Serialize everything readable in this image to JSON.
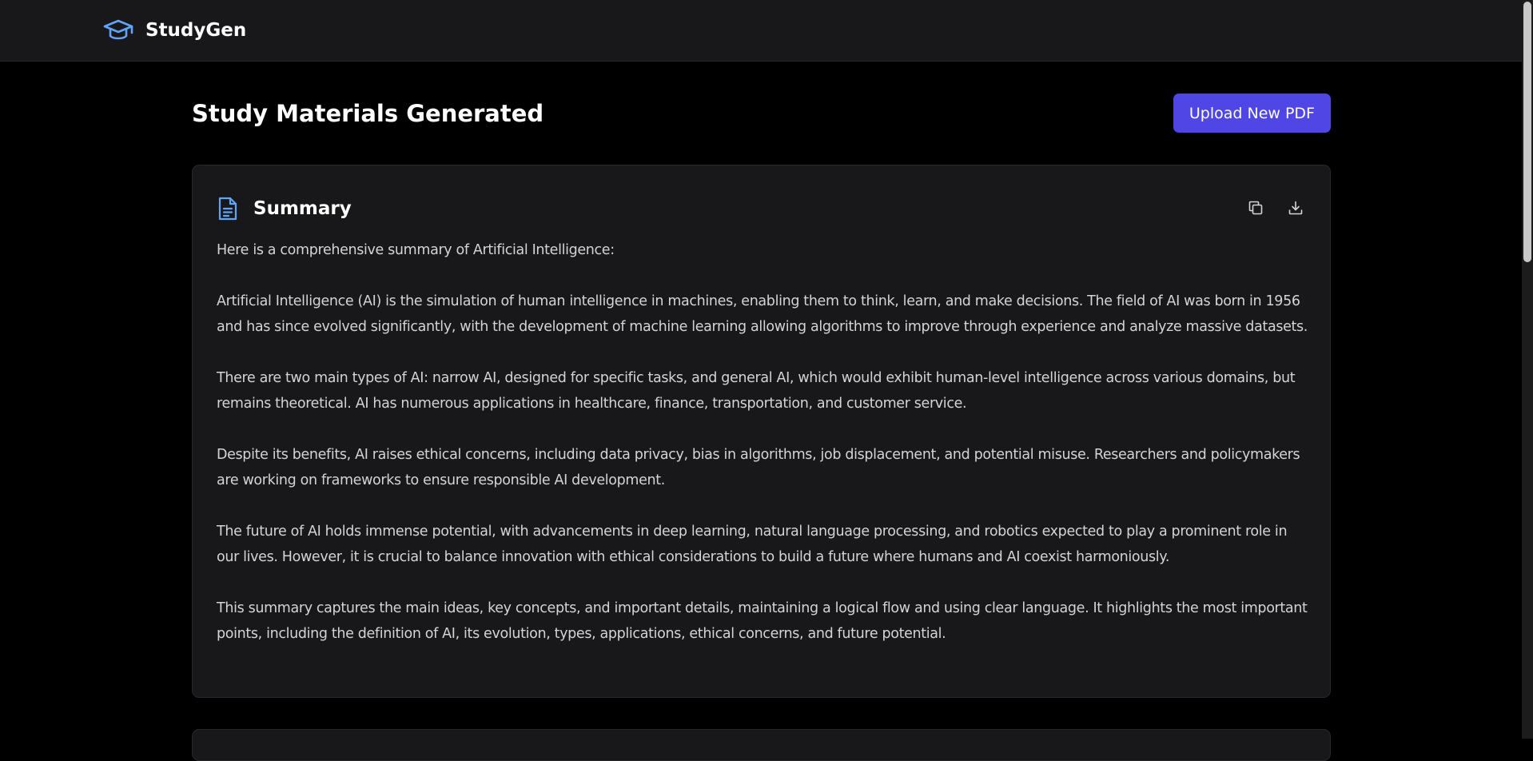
{
  "app": {
    "name": "StudyGen",
    "logo_icon": "graduation-cap-icon"
  },
  "header": {
    "title": "Study Materials Generated",
    "upload_button": "Upload New PDF"
  },
  "summary": {
    "icon": "document-icon",
    "title": "Summary",
    "actions": [
      "copy-icon",
      "download-icon"
    ],
    "paragraphs": [
      "Here is a comprehensive summary of Artificial Intelligence:",
      "Artificial Intelligence (AI) is the simulation of human intelligence in machines, enabling them to think, learn, and make decisions. The field of AI was born in 1956 and has since evolved significantly, with the development of machine learning allowing algorithms to improve through experience and analyze massive datasets.",
      "There are two main types of AI: narrow AI, designed for specific tasks, and general AI, which would exhibit human-level intelligence across various domains, but remains theoretical. AI has numerous applications in healthcare, finance, transportation, and customer service.",
      "Despite its benefits, AI raises ethical concerns, including data privacy, bias in algorithms, job displacement, and potential misuse. Researchers and policymakers are working on frameworks to ensure responsible AI development.",
      "The future of AI holds immense potential, with advancements in deep learning, natural language processing, and robotics expected to play a prominent role in our lives. However, it is crucial to balance innovation with ethical considerations to build a future where humans and AI coexist harmoniously.",
      "This summary captures the main ideas, key concepts, and important details, maintaining a logical flow and using clear language. It highlights the most important points, including the definition of AI, its evolution, types, applications, ethical concerns, and future potential."
    ]
  },
  "colors": {
    "accent": "#4f46e5",
    "icon_blue": "#60a5fa",
    "background": "#000000",
    "surface": "#18181b"
  }
}
